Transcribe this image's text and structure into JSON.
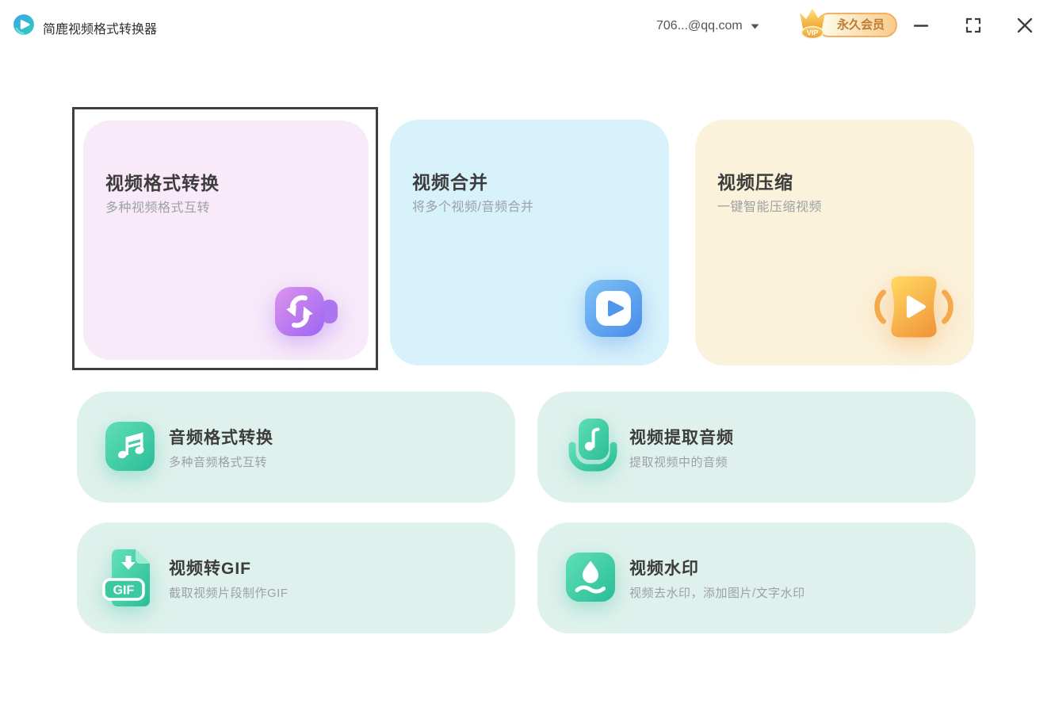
{
  "titlebar": {
    "app_title": "简鹿视频格式转换器",
    "account_email": "706...@qq.com",
    "vip_badge_label": "永久会员",
    "vip_crown_label": "VIP"
  },
  "cards": {
    "featured": [
      {
        "title": "视频格式转换",
        "subtitle": "多种视频格式互转",
        "selected": true
      },
      {
        "title": "视频合并",
        "subtitle": "将多个视频/音频合并",
        "selected": false
      },
      {
        "title": "视频压缩",
        "subtitle": "一键智能压缩视频",
        "selected": false
      }
    ],
    "tools": [
      {
        "title": "音频格式转换",
        "subtitle": "多种音频格式互转"
      },
      {
        "title": "视频提取音频",
        "subtitle": "提取视频中的音频"
      },
      {
        "title": "视频转GIF",
        "subtitle": "截取视频片段制作GIF",
        "badge": "GIF"
      },
      {
        "title": "视频水印",
        "subtitle": "视频去水印，添加图片/文字水印"
      }
    ]
  },
  "icons": {
    "app_logo": "play-circle",
    "account_caret": "chevron-down",
    "vip": "crown",
    "window": [
      "minimize",
      "maximize",
      "close"
    ],
    "featured": [
      "video-convert-sync",
      "video-merge-play",
      "video-compress-squeeze"
    ],
    "tools": [
      "music-note",
      "microphone-note",
      "gif-file",
      "water-drop"
    ]
  },
  "colors": {
    "card_pink_bg": "#F8EAF9",
    "card_cyan_bg": "#D8F2FB",
    "card_cream_bg": "#FBF2DB",
    "card_mint_bg": "#DFF1EC",
    "accent_purple": [
      "#DE92EC",
      "#9B66F2"
    ],
    "accent_blue": [
      "#7EC2F6",
      "#478CE8"
    ],
    "accent_orange": [
      "#FFD55F",
      "#F1973C"
    ],
    "accent_teal": [
      "#5FDFB6",
      "#2ABD97"
    ],
    "selected_border": "#3F3F3F",
    "title_text": "#3C3C3C",
    "subtitle_text": "#9DA1A5",
    "vip_text": "#BE7B33",
    "vip_border": "#F5AF62"
  }
}
